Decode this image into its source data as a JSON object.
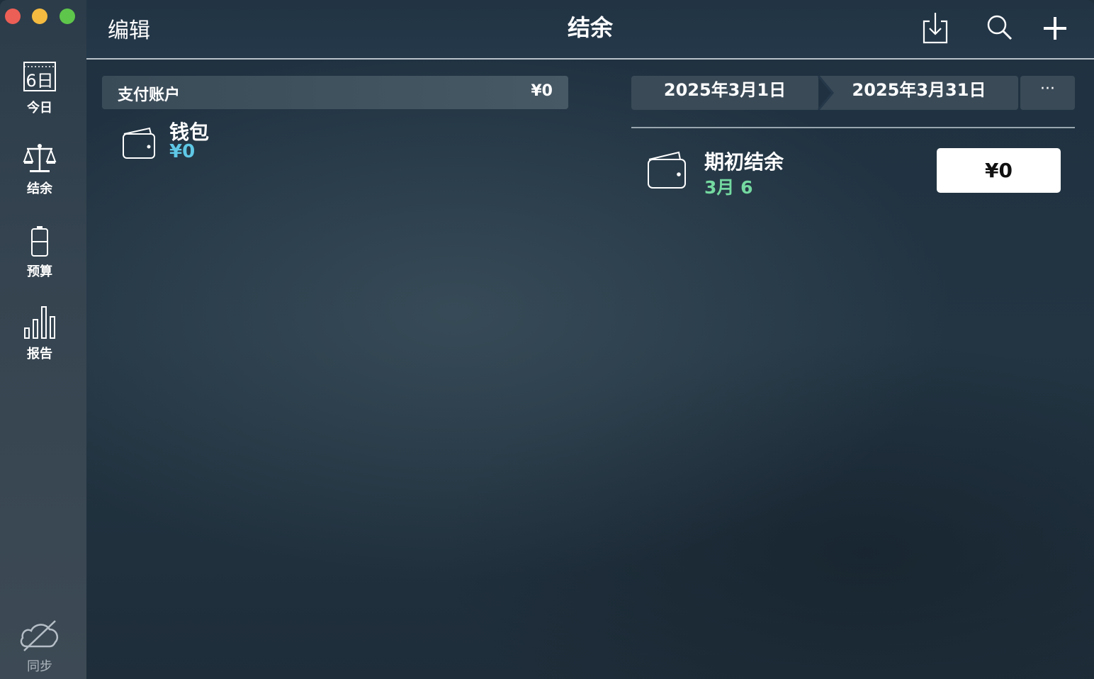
{
  "sidebar": {
    "items": [
      {
        "label": "今日",
        "icon": "calendar-icon",
        "icon_text": "6日"
      },
      {
        "label": "结余",
        "icon": "balance-scale-icon"
      },
      {
        "label": "预算",
        "icon": "battery-icon"
      },
      {
        "label": "报告",
        "icon": "bar-chart-icon"
      }
    ],
    "sync": {
      "label": "同步",
      "icon": "cloud-off-icon"
    }
  },
  "toolbar": {
    "edit_label": "编辑",
    "title": "结余",
    "icons": [
      "download-icon",
      "search-icon",
      "plus-icon"
    ]
  },
  "accounts": {
    "group_name": "支付账户",
    "group_total": "¥0",
    "items": [
      {
        "name": "钱包",
        "amount": "¥0",
        "icon": "wallet-icon"
      }
    ]
  },
  "period": {
    "start": "2025年3月1日",
    "end": "2025年3月31日",
    "more": "···"
  },
  "opening_balance": {
    "label": "期初结余",
    "date": "3月 6",
    "amount": "¥0",
    "icon": "wallet-icon"
  },
  "colors": {
    "accent_blue": "#5fc8e6",
    "accent_green": "#74d9a0",
    "traffic_red": "#ec5f56",
    "traffic_yellow": "#f4bb40",
    "traffic_green": "#5ec64b"
  }
}
